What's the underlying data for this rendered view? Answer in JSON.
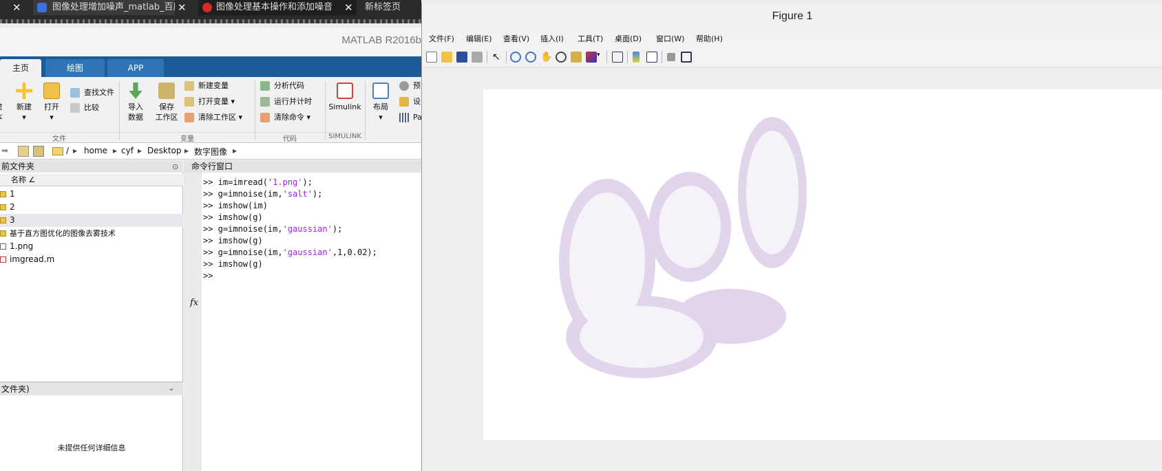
{
  "browser": {
    "tabs": [
      {
        "label": "图像处理增加噪声_matlab_百度"
      },
      {
        "label": "图像处理基本操作和添加噪音"
      },
      {
        "label": "新标签页"
      }
    ],
    "close_glyph": "✕"
  },
  "matlab": {
    "title": "MATLAB R2016b",
    "ribbon_tabs": [
      "主页",
      "绘图",
      "APP"
    ],
    "ribbon": {
      "new_script_frag": "建",
      "new_script_frag2": "本",
      "new": "新建",
      "open": "打开",
      "find_files": "查找文件",
      "compare": "比较",
      "import": "导入",
      "import2": "数据",
      "save_ws": "保存",
      "save_ws2": "工作区",
      "new_var": "新建变量",
      "open_var": "打开变量",
      "clear_ws": "清除工作区",
      "analyze": "分析代码",
      "run_time": "运行并计时",
      "clear_cmd": "清除命令",
      "simulink": "Simulink",
      "layout": "布局",
      "prefs_frag": "预",
      "set_frag": "设",
      "pa_frag": "Pa",
      "groups": [
        "文件",
        "变量",
        "代码",
        "SIMULINK"
      ]
    },
    "address": [
      "/",
      "home",
      "cyf",
      "Desktop",
      "数字图像"
    ],
    "folder": {
      "title": "前文件夹",
      "col_name": "名称 ∠",
      "items": [
        {
          "name": "1",
          "type": "folder"
        },
        {
          "name": "2",
          "type": "folder"
        },
        {
          "name": "3",
          "type": "folder"
        },
        {
          "name": "基于直方图优化的图像去雾技术",
          "type": "folder"
        },
        {
          "name": "1.png",
          "type": "file"
        },
        {
          "name": "imgread.m",
          "type": "file"
        }
      ],
      "details_title": "文件夹)",
      "details_msg": "未提供任何详细信息"
    },
    "command": {
      "title": "命令行窗口",
      "lines": [
        [
          ">> im=imread(",
          "'1.png'",
          ");"
        ],
        [
          ">> g=imnoise(im,",
          "'salt'",
          ");"
        ],
        [
          ">> imshow(im)",
          "",
          ""
        ],
        [
          ">> imshow(g)",
          "",
          ""
        ],
        [
          ">> g=imnoise(im,",
          "'gaussian'",
          ");"
        ],
        [
          ">> imshow(g)",
          "",
          ""
        ],
        [
          ">> g=imnoise(im,",
          "'gaussian'",
          ",1,0.02);"
        ],
        [
          ">> imshow(g)",
          "",
          ""
        ]
      ],
      "prompt": ">>",
      "fx": "fx"
    }
  },
  "figure": {
    "title": "Figure 1",
    "menu": [
      "文件(F)",
      "编辑(E)",
      "查看(V)",
      "插入(I)",
      "工具(T)",
      "桌面(D)",
      "窗口(W)",
      "帮助(H)"
    ]
  }
}
